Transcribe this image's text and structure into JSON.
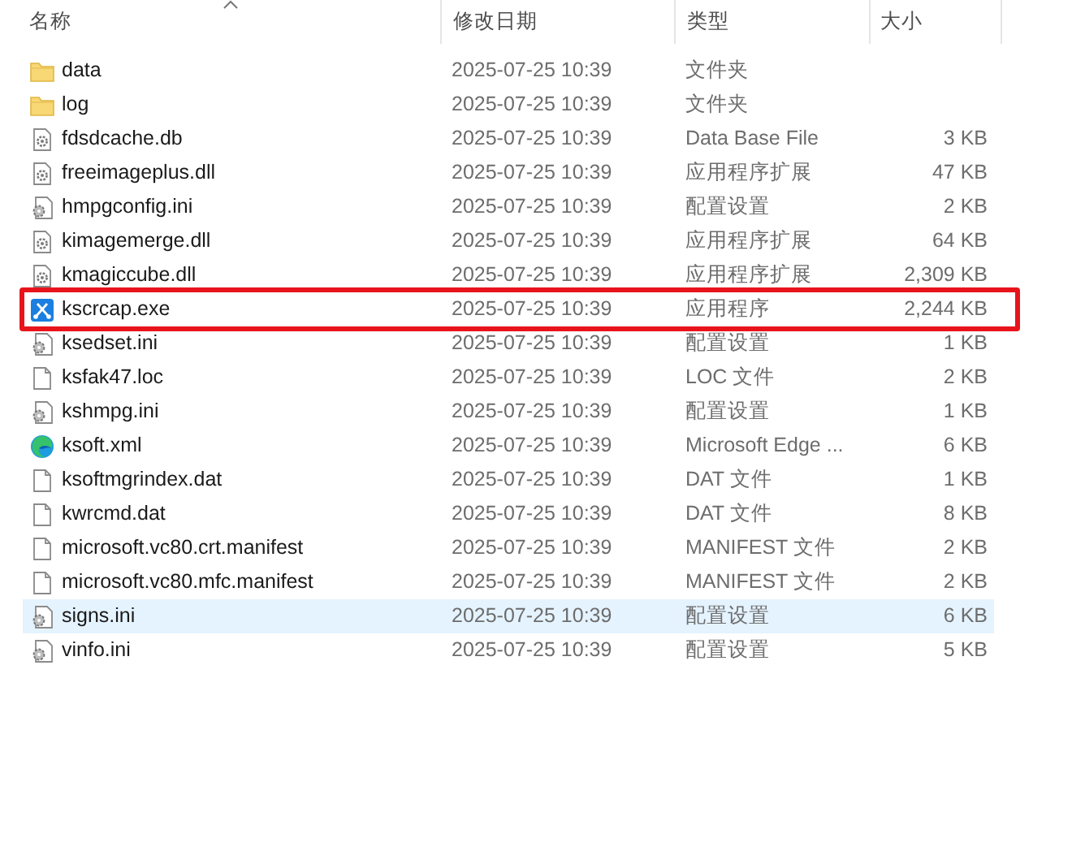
{
  "columns": [
    {
      "label": "名称",
      "sorted": true
    },
    {
      "label": "修改日期",
      "sorted": false
    },
    {
      "label": "类型",
      "sorted": false
    },
    {
      "label": "大小",
      "sorted": false
    }
  ],
  "rows": [
    {
      "kind": "folder",
      "name": "data",
      "date": "2025-07-25 10:39",
      "type": "文件夹",
      "hovered": false,
      "annotated": false
    },
    {
      "kind": "folder",
      "name": "log",
      "date": "2025-07-25 10:39",
      "type": "文件夹",
      "hovered": false,
      "annotated": false
    },
    {
      "kind": "library",
      "name": "fdsdcache.db",
      "date": "2025-07-25 10:39",
      "type": "Data Base File",
      "size": "3 KB",
      "hovered": false,
      "annotated": false
    },
    {
      "kind": "library",
      "name": "freeimageplus.dll",
      "date": "2025-07-25 10:39",
      "type": "应用程序扩展",
      "size": "47 KB",
      "hovered": false,
      "annotated": false
    },
    {
      "kind": "settings",
      "name": "hmpgconfig.ini",
      "date": "2025-07-25 10:39",
      "type": "配置设置",
      "size": "2 KB",
      "hovered": false,
      "annotated": false
    },
    {
      "kind": "library",
      "name": "kimagemerge.dll",
      "date": "2025-07-25 10:39",
      "type": "应用程序扩展",
      "size": "64 KB",
      "hovered": false,
      "annotated": false
    },
    {
      "kind": "library",
      "name": "kmagiccube.dll",
      "date": "2025-07-25 10:39",
      "type": "应用程序扩展",
      "size": "2,309 KB",
      "hovered": false,
      "annotated": false
    },
    {
      "kind": "app",
      "name": "kscrcap.exe",
      "date": "2025-07-25 10:39",
      "type": "应用程序",
      "size": "2,244 KB",
      "hovered": false,
      "annotated": true
    },
    {
      "kind": "settings",
      "name": "ksedset.ini",
      "date": "2025-07-25 10:39",
      "type": "配置设置",
      "size": "1 KB",
      "hovered": false,
      "annotated": false
    },
    {
      "kind": "file",
      "name": "ksfak47.loc",
      "date": "2025-07-25 10:39",
      "type": "LOC 文件",
      "size": "2 KB",
      "hovered": false,
      "annotated": false
    },
    {
      "kind": "settings",
      "name": "kshmpg.ini",
      "date": "2025-07-25 10:39",
      "type": "配置设置",
      "size": "1 KB",
      "hovered": false,
      "annotated": false
    },
    {
      "kind": "browser",
      "name": "ksoft.xml",
      "date": "2025-07-25 10:39",
      "type": "Microsoft Edge ...",
      "size": "6 KB",
      "hovered": false,
      "annotated": false
    },
    {
      "kind": "file",
      "name": "ksoftmgrindex.dat",
      "date": "2025-07-25 10:39",
      "type": "DAT 文件",
      "size": "1 KB",
      "hovered": false,
      "annotated": false
    },
    {
      "kind": "file",
      "name": "kwrcmd.dat",
      "date": "2025-07-25 10:39",
      "type": "DAT 文件",
      "size": "8 KB",
      "hovered": false,
      "annotated": false
    },
    {
      "kind": "file",
      "name": "microsoft.vc80.crt.manifest",
      "date": "2025-07-25 10:39",
      "type": "MANIFEST 文件",
      "size": "2 KB",
      "hovered": false,
      "annotated": false
    },
    {
      "kind": "file",
      "name": "microsoft.vc80.mfc.manifest",
      "date": "2025-07-25 10:39",
      "type": "MANIFEST 文件",
      "size": "2 KB",
      "hovered": false,
      "annotated": false
    },
    {
      "kind": "settings",
      "name": "signs.ini",
      "date": "2025-07-25 10:39",
      "type": "配置设置",
      "size": "6 KB",
      "hovered": true,
      "annotated": false
    },
    {
      "kind": "settings",
      "name": "vinfo.ini",
      "date": "2025-07-25 10:39",
      "type": "配置设置",
      "size": "5 KB",
      "hovered": false,
      "annotated": false
    }
  ]
}
